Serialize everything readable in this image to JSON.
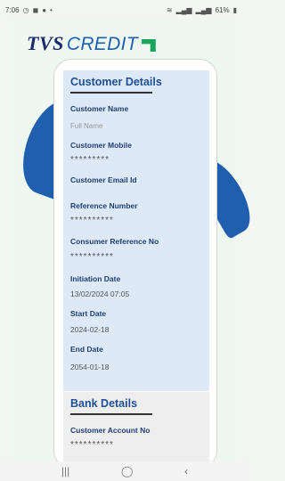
{
  "status_bar": {
    "time": "7:06",
    "battery": "61%"
  },
  "logo": {
    "brand_prefix": "TVS",
    "brand_suffix": "CREDIT"
  },
  "customer_details": {
    "title": "Customer Details",
    "fields": [
      {
        "label": "Customer Name",
        "value": "Full Name"
      },
      {
        "label": "Customer Mobile",
        "value": "*********"
      },
      {
        "label": "Customer Email Id",
        "value": ""
      },
      {
        "label": "Reference Number",
        "value": "**********"
      },
      {
        "label": "Consumer Reference No",
        "value": "**********"
      },
      {
        "label": "Initiation Date",
        "value": "13/02/2024 07:05"
      },
      {
        "label": "Start Date",
        "value": "2024-02-18"
      },
      {
        "label": "End Date",
        "value": "2054-01-18"
      }
    ]
  },
  "bank_details": {
    "title": "Bank Details",
    "fields": [
      {
        "label": "Customer Account No",
        "value": "**********"
      }
    ]
  },
  "nav_bar": {
    "recents_icon": "recents-icon",
    "home_icon": "home-icon",
    "back_icon": "back-icon"
  }
}
